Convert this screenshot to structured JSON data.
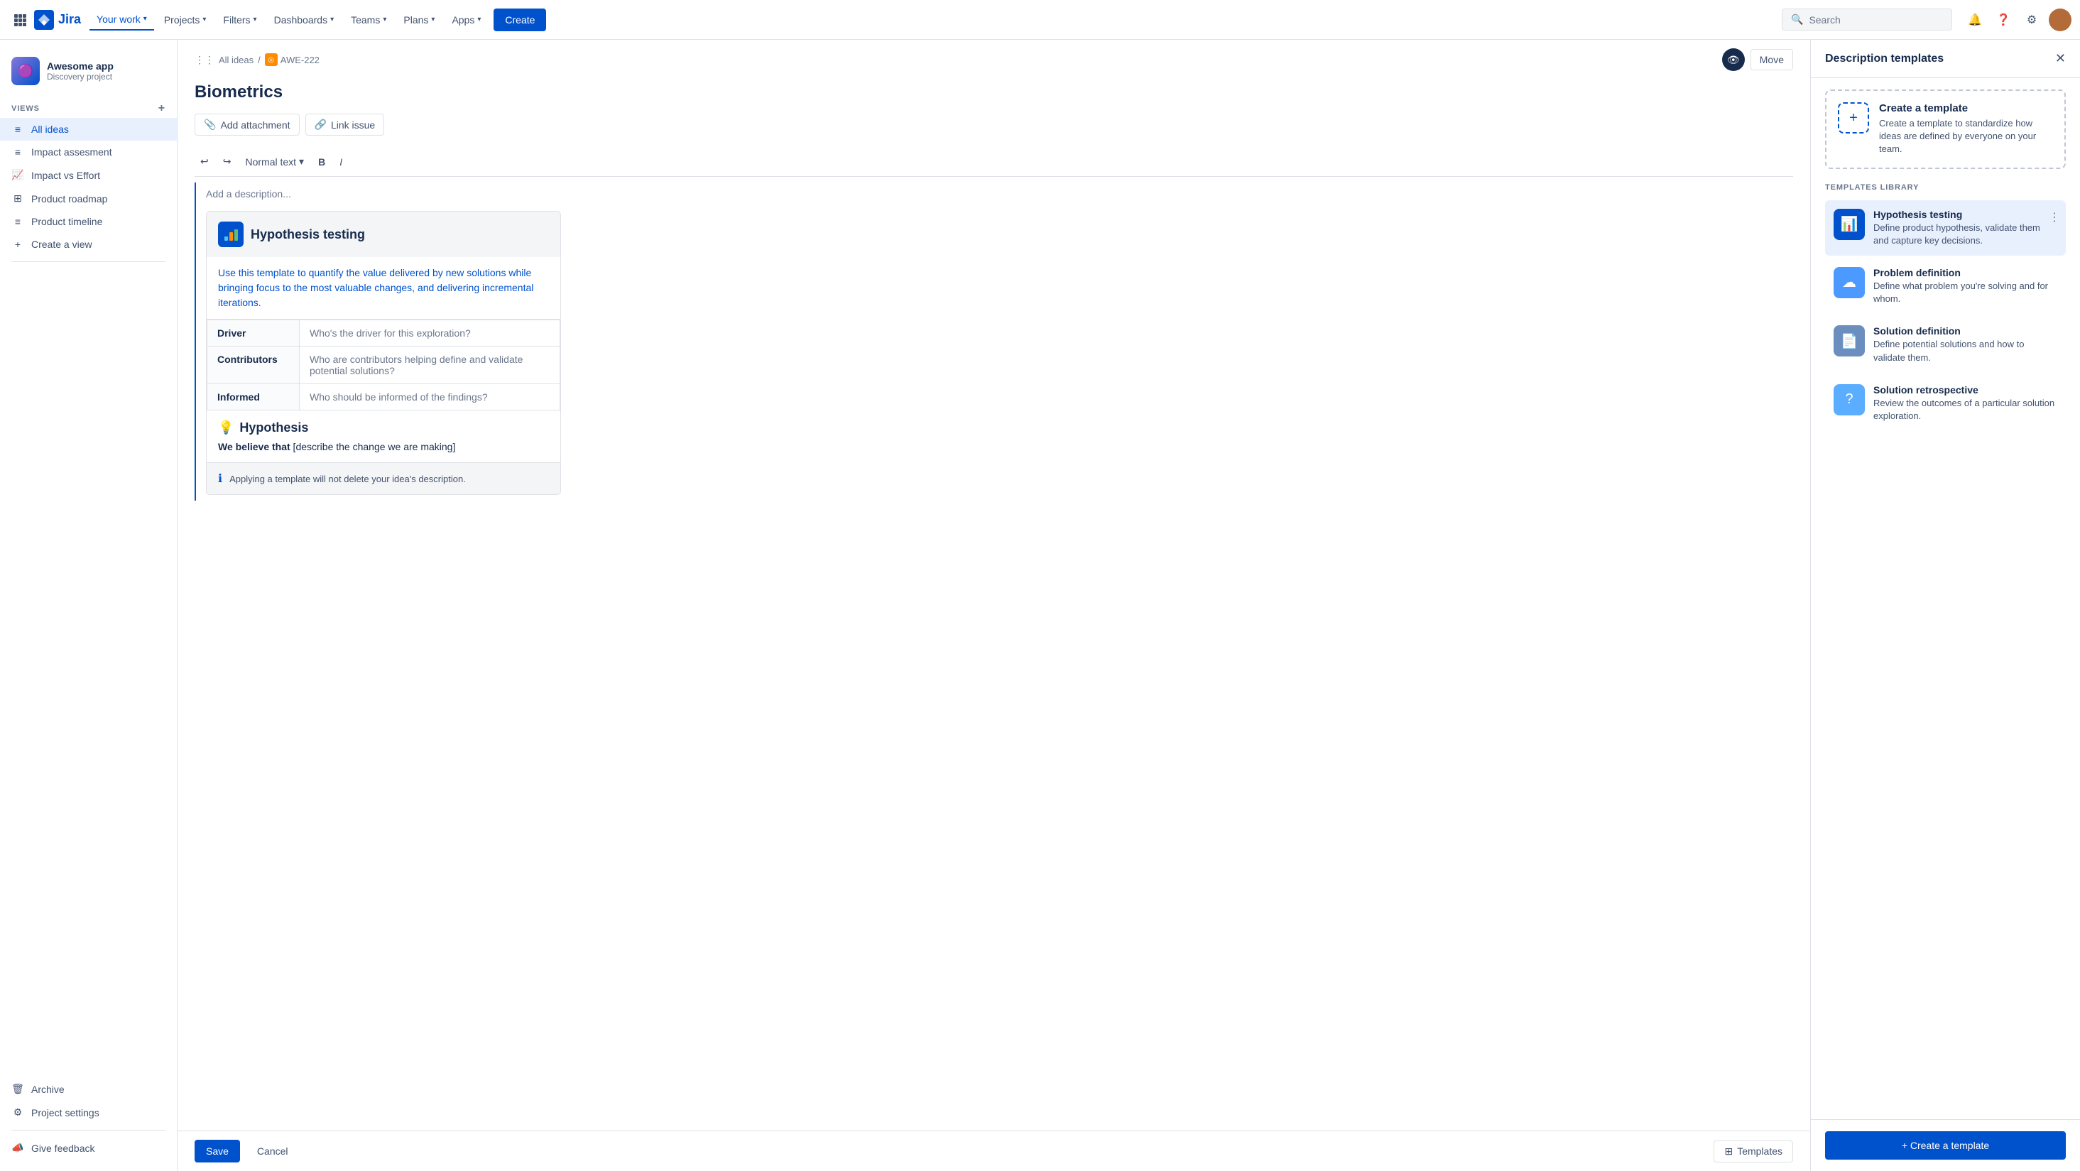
{
  "topnav": {
    "logo_text": "Jira",
    "your_work": "Your work",
    "projects": "Projects",
    "filters": "Filters",
    "dashboards": "Dashboards",
    "teams": "Teams",
    "plans": "Plans",
    "apps": "Apps",
    "create_btn": "Create",
    "search_placeholder": "Search"
  },
  "sidebar": {
    "project_name": "Awesome app",
    "project_type": "Discovery project",
    "views_label": "VIEWS",
    "items": [
      {
        "label": "All ideas",
        "icon": "≡",
        "active": true
      },
      {
        "label": "Impact assesment",
        "icon": "≡"
      },
      {
        "label": "Impact vs Effort",
        "icon": "📈"
      },
      {
        "label": "Product roadmap",
        "icon": "⊞"
      },
      {
        "label": "Product timeline",
        "icon": "≡"
      },
      {
        "label": "Create a view",
        "icon": "+"
      }
    ],
    "archive": "Archive",
    "project_settings": "Project settings",
    "give_feedback": "Give feedback"
  },
  "breadcrumb": {
    "all_ideas": "All ideas",
    "issue_id": "AWE-222",
    "move_btn": "Move"
  },
  "issue": {
    "title": "Biometrics",
    "add_attachment": "Add attachment",
    "link_issue": "Link issue",
    "editor_format": "Normal text",
    "description_placeholder": "Add a description..."
  },
  "template_preview": {
    "title": "Hypothesis testing",
    "description": "Use this template to quantify the value delivered by new solutions while bringing focus to the most valuable changes, and delivering incremental iterations.",
    "table_rows": [
      {
        "label": "Driver",
        "value": "Who's the driver for this exploration?"
      },
      {
        "label": "Contributors",
        "value": "Who are contributors helping define and validate potential solutions?"
      },
      {
        "label": "Informed",
        "value": "Who should be informed of the findings?"
      }
    ],
    "hypothesis_title": "Hypothesis",
    "hypothesis_body_prefix": "We believe that",
    "hypothesis_body_rest": " [describe the change we are making]",
    "notice": "Applying a template will not delete your idea's description."
  },
  "editor_bottom": {
    "save": "Save",
    "cancel": "Cancel",
    "templates": "Templates"
  },
  "right_panel": {
    "title": "Description templates",
    "create_template_title": "Create a template",
    "create_template_desc": "Create a template to standardize how ideas are defined by everyone on your team.",
    "library_label": "TEMPLATES LIBRARY",
    "templates": [
      {
        "name": "Hypothesis testing",
        "desc": "Define product hypothesis, validate them and capture key decisions.",
        "icon_type": "blue",
        "icon_char": "📊"
      },
      {
        "name": "Problem definition",
        "desc": "Define what problem you're solving and for whom.",
        "icon_type": "light-blue",
        "icon_char": "☁"
      },
      {
        "name": "Solution definition",
        "desc": "Define potential solutions and how to validate them.",
        "icon_type": "gray-blue",
        "icon_char": "📄"
      },
      {
        "name": "Solution retrospective",
        "desc": "Review the outcomes of a particular solution exploration.",
        "icon_type": "blue-q",
        "icon_char": "?"
      }
    ],
    "create_big_btn": "+ Create a template"
  }
}
